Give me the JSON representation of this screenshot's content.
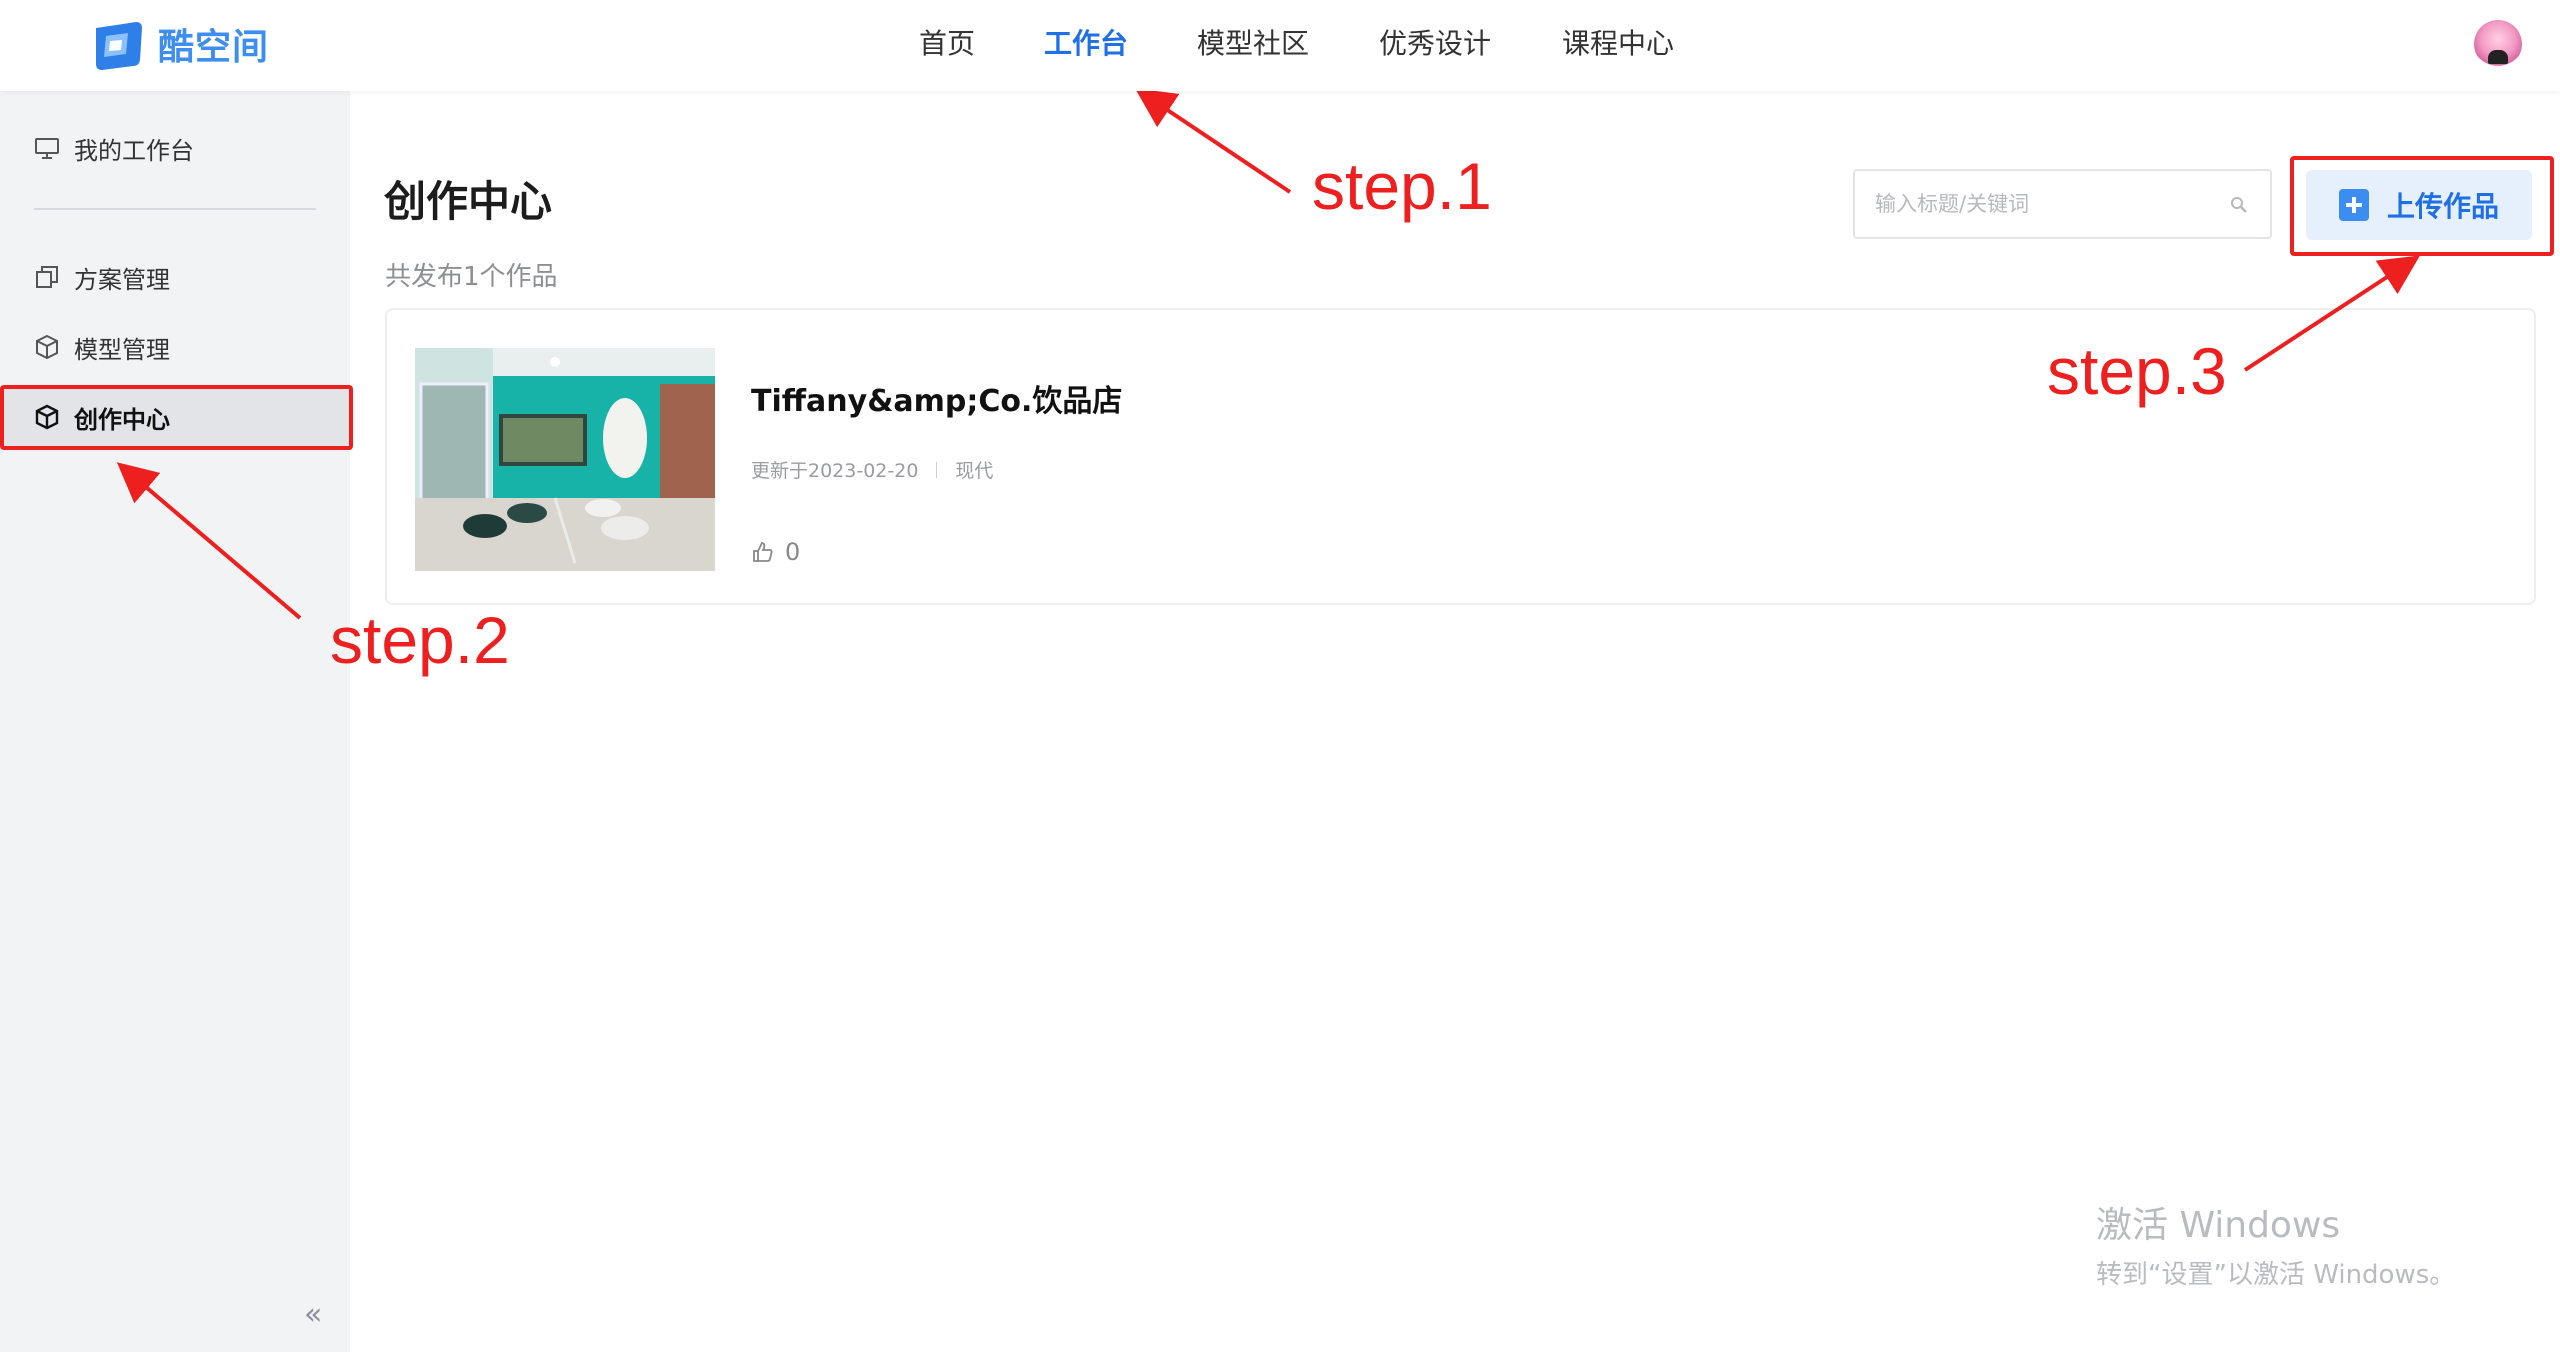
{
  "topbar": {
    "logo_text": "酷空间",
    "nav": [
      {
        "label": "首页"
      },
      {
        "label": "工作台"
      },
      {
        "label": "模型社区"
      },
      {
        "label": "优秀设计"
      },
      {
        "label": "课程中心"
      }
    ],
    "active_nav": "工作台"
  },
  "sidebar": {
    "items": [
      {
        "label": "我的工作台",
        "icon": "monitor-icon"
      },
      {
        "label": "方案管理",
        "icon": "copy-icon"
      },
      {
        "label": "模型管理",
        "icon": "cube-icon"
      },
      {
        "label": "创作中心",
        "icon": "cube-icon",
        "active": true
      }
    ],
    "collapse_glyph": "«"
  },
  "main": {
    "title": "创作中心",
    "count_text": "共发布1个作品",
    "search": {
      "placeholder": "输入标题/关键词",
      "value": ""
    },
    "upload_label": "上传作品",
    "works": [
      {
        "title": "Tiffany&amp;Co.饮品店",
        "updated": "更新于2023-02-20",
        "style": "现代",
        "likes": "0"
      }
    ]
  },
  "annotations": {
    "step1": "step.1",
    "step2": "step.2",
    "step3": "step.3"
  },
  "watermark": {
    "line1": "激活 Windows",
    "line2": "转到“设置”以激活 Windows。"
  },
  "colors": {
    "accent": "#1f6fe5",
    "annotation": "#ee1f1f",
    "sidebar_bg": "#f2f3f5"
  }
}
